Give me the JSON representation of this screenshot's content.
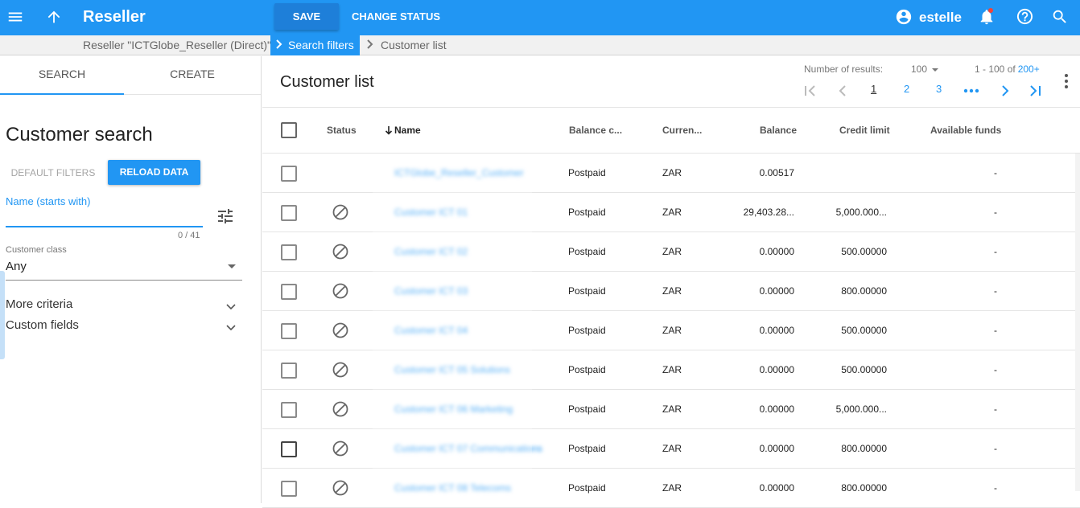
{
  "appbar": {
    "title": "Reseller",
    "save_label": "SAVE",
    "change_status_label": "CHANGE STATUS",
    "user_name": "estelle",
    "accent_color": "#2196f3"
  },
  "breadcrumb": {
    "reseller": "Reseller \"ICTGlobe_Reseller (Direct)\"",
    "current": "Search filters",
    "next": "Customer list"
  },
  "left": {
    "tabs": [
      "SEARCH",
      "CREATE"
    ],
    "title": "Customer search",
    "default_filters_label": "DEFAULT FILTERS",
    "reload_label": "RELOAD DATA",
    "name_label": "Name (starts with)",
    "name_value": "",
    "name_counter": "0 / 41",
    "class_label": "Customer class",
    "class_value": "Any",
    "more_criteria": "More criteria",
    "custom_fields": "Custom fields"
  },
  "main": {
    "title": "Customer list",
    "results_label": "Number of results:",
    "results_per_page": "100",
    "range": "1 - 100 of",
    "total": "200+",
    "pages": [
      "1",
      "2",
      "3"
    ],
    "columns": {
      "status": "Status",
      "name": "Name",
      "balance_control": "Balance c...",
      "currency": "Curren...",
      "balance": "Balance",
      "credit_limit": "Credit limit",
      "available_funds": "Available funds"
    },
    "rows": [
      {
        "name": "ICTGlobe_Reseller_Customer",
        "has_status_icon": false,
        "balance_control": "Postpaid",
        "currency": "ZAR",
        "balance": "0.00517",
        "credit_limit": "",
        "available_funds": "-"
      },
      {
        "name": "Customer ICT 01",
        "has_status_icon": true,
        "balance_control": "Postpaid",
        "currency": "ZAR",
        "balance": "29,403.28...",
        "credit_limit": "5,000.000...",
        "available_funds": "-"
      },
      {
        "name": "Customer ICT 02",
        "has_status_icon": true,
        "balance_control": "Postpaid",
        "currency": "ZAR",
        "balance": "0.00000",
        "credit_limit": "500.00000",
        "available_funds": "-"
      },
      {
        "name": "Customer ICT 03",
        "has_status_icon": true,
        "balance_control": "Postpaid",
        "currency": "ZAR",
        "balance": "0.00000",
        "credit_limit": "800.00000",
        "available_funds": "-"
      },
      {
        "name": "Customer ICT 04",
        "has_status_icon": true,
        "balance_control": "Postpaid",
        "currency": "ZAR",
        "balance": "0.00000",
        "credit_limit": "500.00000",
        "available_funds": "-"
      },
      {
        "name": "Customer ICT 05 Solutions",
        "has_status_icon": true,
        "balance_control": "Postpaid",
        "currency": "ZAR",
        "balance": "0.00000",
        "credit_limit": "500.00000",
        "available_funds": "-"
      },
      {
        "name": "Customer ICT 06 Marketing",
        "has_status_icon": true,
        "balance_control": "Postpaid",
        "currency": "ZAR",
        "balance": "0.00000",
        "credit_limit": "5,000.000...",
        "available_funds": "-"
      },
      {
        "name": "Customer ICT 07 Communications",
        "has_status_icon": true,
        "balance_control": "Postpaid",
        "currency": "ZAR",
        "balance": "0.00000",
        "credit_limit": "800.00000",
        "available_funds": "-"
      },
      {
        "name": "Customer ICT 08 Telecoms",
        "has_status_icon": true,
        "balance_control": "Postpaid",
        "currency": "ZAR",
        "balance": "0.00000",
        "credit_limit": "800.00000",
        "available_funds": "-"
      }
    ]
  }
}
